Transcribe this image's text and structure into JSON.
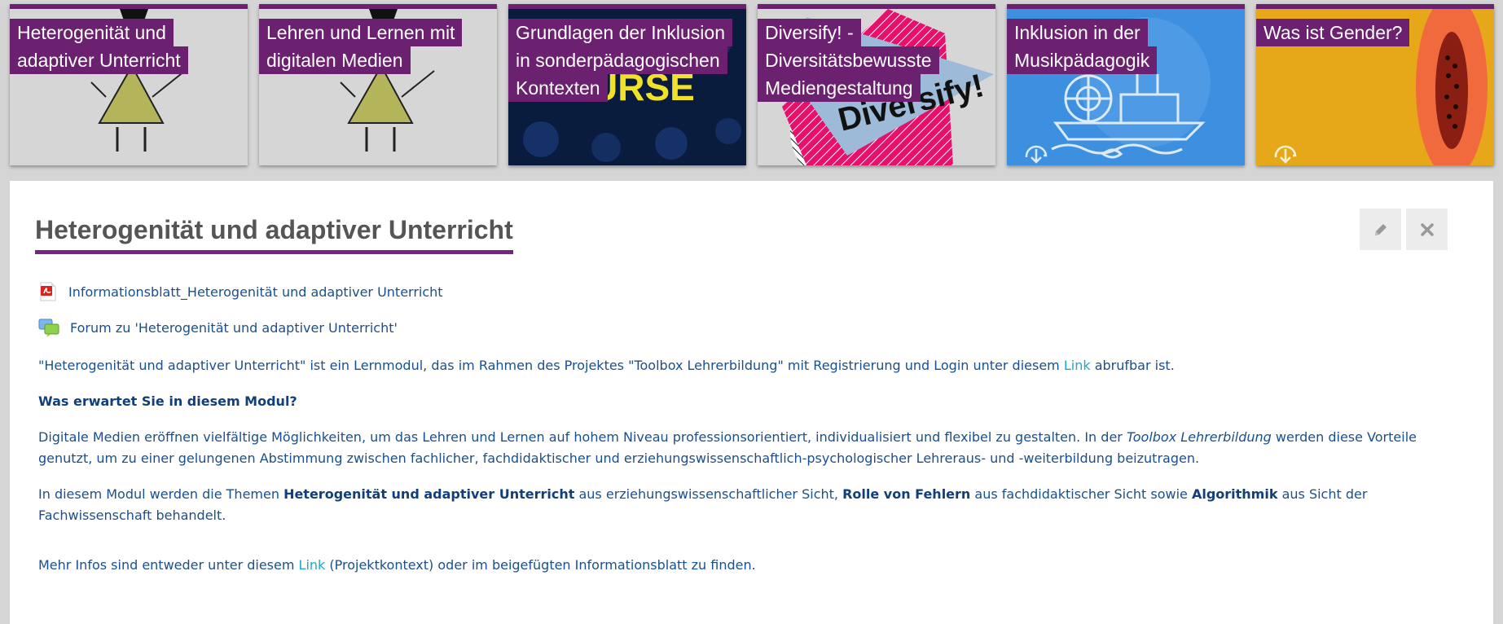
{
  "tiles": [
    {
      "line1": "Heterogenität und",
      "line2": "adaptiver Unterricht"
    },
    {
      "line1": "Lehren und Lernen mit",
      "line2": "digitalen Medien"
    },
    {
      "line1": "Grundlagen der Inklusion",
      "line2": "in sonderpädagogischen",
      "line3": "Kontexten",
      "bg_text": "COURSE"
    },
    {
      "line1": "Diversify! -",
      "line2": "Diversitätsbewusste",
      "line3": "Mediengestaltung",
      "bg_text": "Diversify!"
    },
    {
      "line1": "Inklusion in der",
      "line2": "Musikpädagogik"
    },
    {
      "line1": "Was ist Gender?"
    }
  ],
  "module": {
    "title": "Heterogenität und adaptiver Unterricht",
    "resources": [
      {
        "icon": "pdf-icon",
        "label": "Informationsblatt_Heterogenität und adaptiver Unterricht"
      },
      {
        "icon": "forum-icon",
        "label": "Forum zu 'Heterogenität und adaptiver Unterricht'"
      }
    ],
    "intro": {
      "before": "\"Heterogenität und adaptiver Unterricht\" ist ein Lernmodul, das im Rahmen des Projektes \"Toolbox Lehrerbildung\" mit Registrierung und Login unter diesem ",
      "link": "Link",
      "after": " abrufbar ist."
    },
    "heading": "Was erwartet Sie in diesem Modul?",
    "para1": {
      "before": "Digitale Medien eröffnen vielfältige Möglichkeiten, um das Lehren und Lernen auf hohem Niveau professionsorientiert, individualisiert und flexibel zu gestalten. In der ",
      "em": "Toolbox Lehrerbildung",
      "after": " werden diese Vorteile genutzt, um zu einer gelungenen Abstimmung zwischen fachlicher, fachdidaktischer und erziehungswissenschaftlich-psychologischer Lehreraus- und -weiterbildung beizutragen."
    },
    "para2": {
      "t1": "In diesem Modul werden die Themen ",
      "b1": "Heterogenität und adaptiver Unterricht",
      "t2": " aus erziehungswissenschaftlicher Sicht, ",
      "b2": "Rolle von Fehlern",
      "t3": " aus fachdidaktischer Sicht sowie ",
      "b3": "Algorithmik",
      "t4": " aus Sicht der Fachwissenschaft behandelt."
    },
    "para3": {
      "before": "Mehr Infos sind entweder unter diesem ",
      "link": "Link",
      "after": " (Projektkontext) oder im beigefügten Informationsblatt zu finden."
    }
  },
  "colors": {
    "accent": "#6c2070",
    "link": "#21a7c9",
    "text": "#1a4f8f"
  }
}
